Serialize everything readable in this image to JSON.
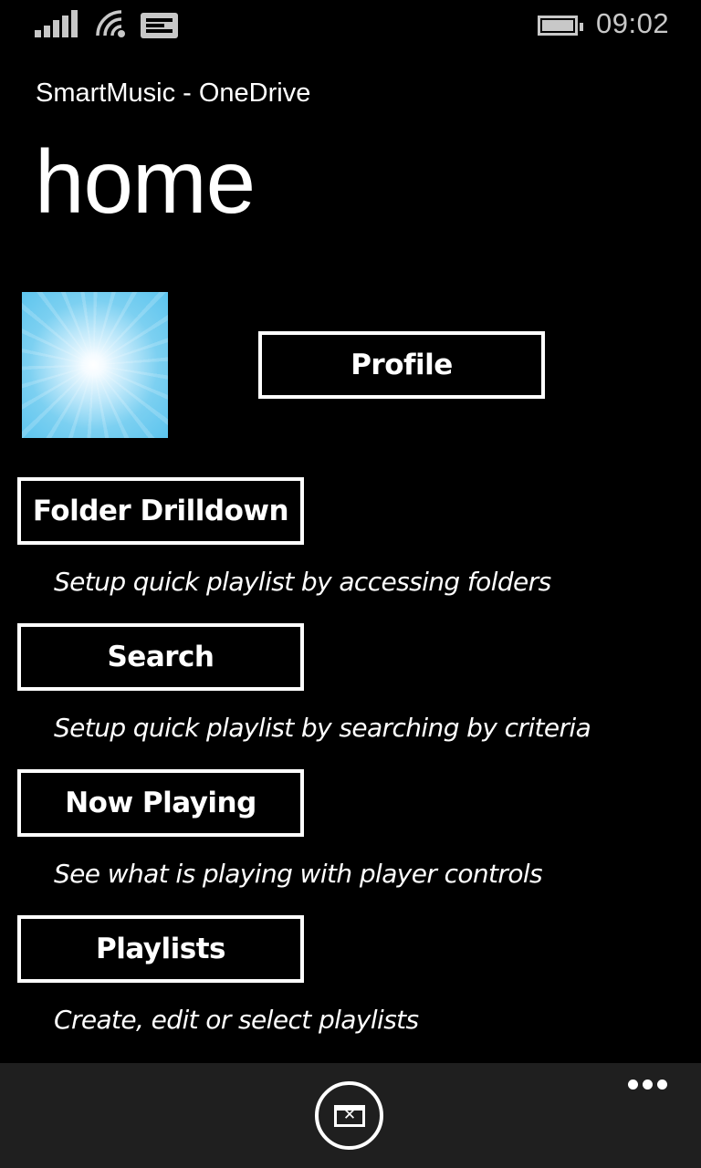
{
  "status_bar": {
    "icons": [
      "signal-strength-icon",
      "wifi-icon",
      "message-icon",
      "battery-icon"
    ],
    "time": "09:02",
    "color": "#c8c8c8"
  },
  "header": {
    "app_title": "SmartMusic - OneDrive",
    "page_title": "home"
  },
  "profile": {
    "avatar": "sunburst-avatar-image",
    "button_label": "Profile"
  },
  "menu": [
    {
      "label": "Folder Drilldown",
      "description": "Setup quick playlist by accessing folders"
    },
    {
      "label": "Search",
      "description": "Setup quick playlist by searching by criteria"
    },
    {
      "label": "Now Playing",
      "description": "See what is playing with player controls"
    },
    {
      "label": "Playlists",
      "description": "Create, edit or select playlists"
    }
  ],
  "app_bar": {
    "button_icon": "close-window-icon",
    "more_icon": "ellipsis-icon",
    "background": "#1f1f1f"
  },
  "colors": {
    "background": "#000000",
    "foreground": "#ffffff"
  }
}
